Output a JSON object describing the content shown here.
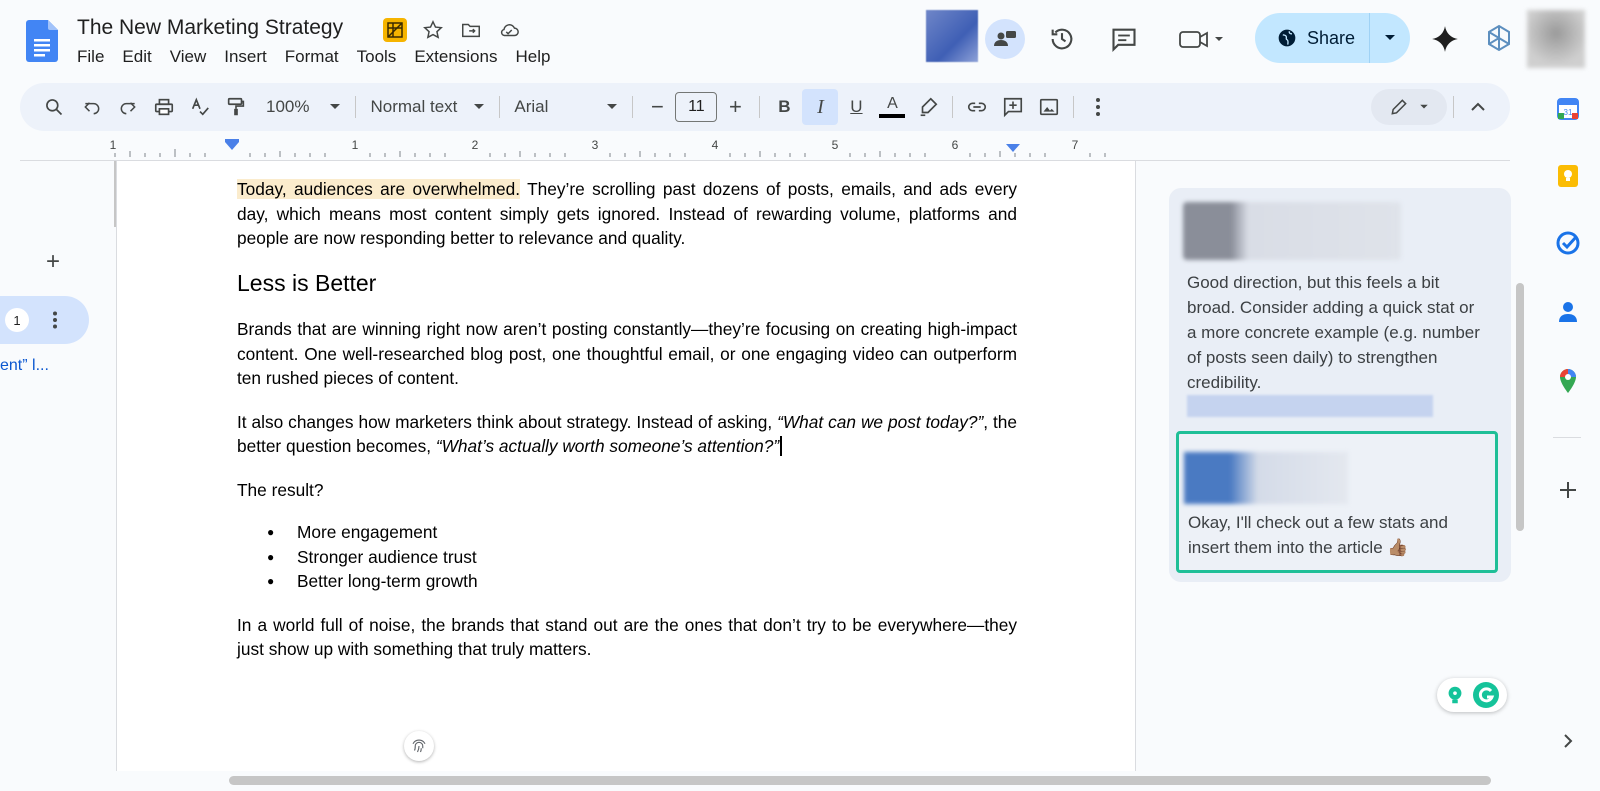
{
  "doc": {
    "title": "The New Marketing Strategy",
    "menu": [
      "File",
      "Edit",
      "View",
      "Insert",
      "Format",
      "Tools",
      "Extensions",
      "Help"
    ]
  },
  "header": {
    "share_label": "Share"
  },
  "toolbar": {
    "zoom": "100%",
    "style": "Normal text",
    "font": "Arial",
    "font_size": "11",
    "bold": "B",
    "italic": "I",
    "underline": "U",
    "text_color": "A",
    "minus": "−",
    "plus": "+"
  },
  "ruler": {
    "labels": [
      "1",
      "1",
      "2",
      "3",
      "4",
      "5",
      "6",
      "7"
    ]
  },
  "outline": {
    "add": "+",
    "badge": "1",
    "heading_link": "ent” l..."
  },
  "body": {
    "p1_highlight": "Today, audiences are overwhelmed.",
    "p1_rest": " They’re scrolling past dozens of posts, emails, and ads every day, which means most content simply gets ignored. Instead of rewarding volume, platforms and people are now responding better to relevance and quality.",
    "heading": "Less is Better",
    "p2": "Brands that are winning right now aren’t posting constantly—they’re focusing on creating high-impact content. One well-researched blog post, one thoughtful email, or one engaging video can outperform ten rushed pieces of content.",
    "p3_a": "It also changes how marketers think about strategy. Instead of asking, ",
    "p3_q1": "“What can we post today?”",
    "p3_b": ", the better question becomes, ",
    "p3_q2": "“What’s actually worth someone’s attention?”",
    "p4": "The result?",
    "bullets": [
      "More engagement",
      "Stronger audience trust",
      "Better long-term growth"
    ],
    "p5": "In a world full of noise, the brands that stand out are the ones that don’t try to be everywhere—they just show up with something that truly matters."
  },
  "comments": {
    "c1_text": "Good direction, but this feels a bit broad. Consider adding a quick stat or a more concrete example (e.g. number of posts seen daily) to strengthen credibility.",
    "c2_text": "Okay, I'll check out a few stats and insert them into the article 👍🏽"
  },
  "colors": {
    "accent": "#0b57d0",
    "share_bg": "#c2e7ff",
    "highlight": "#fbeccd",
    "comment_border": "#1fbf97"
  }
}
